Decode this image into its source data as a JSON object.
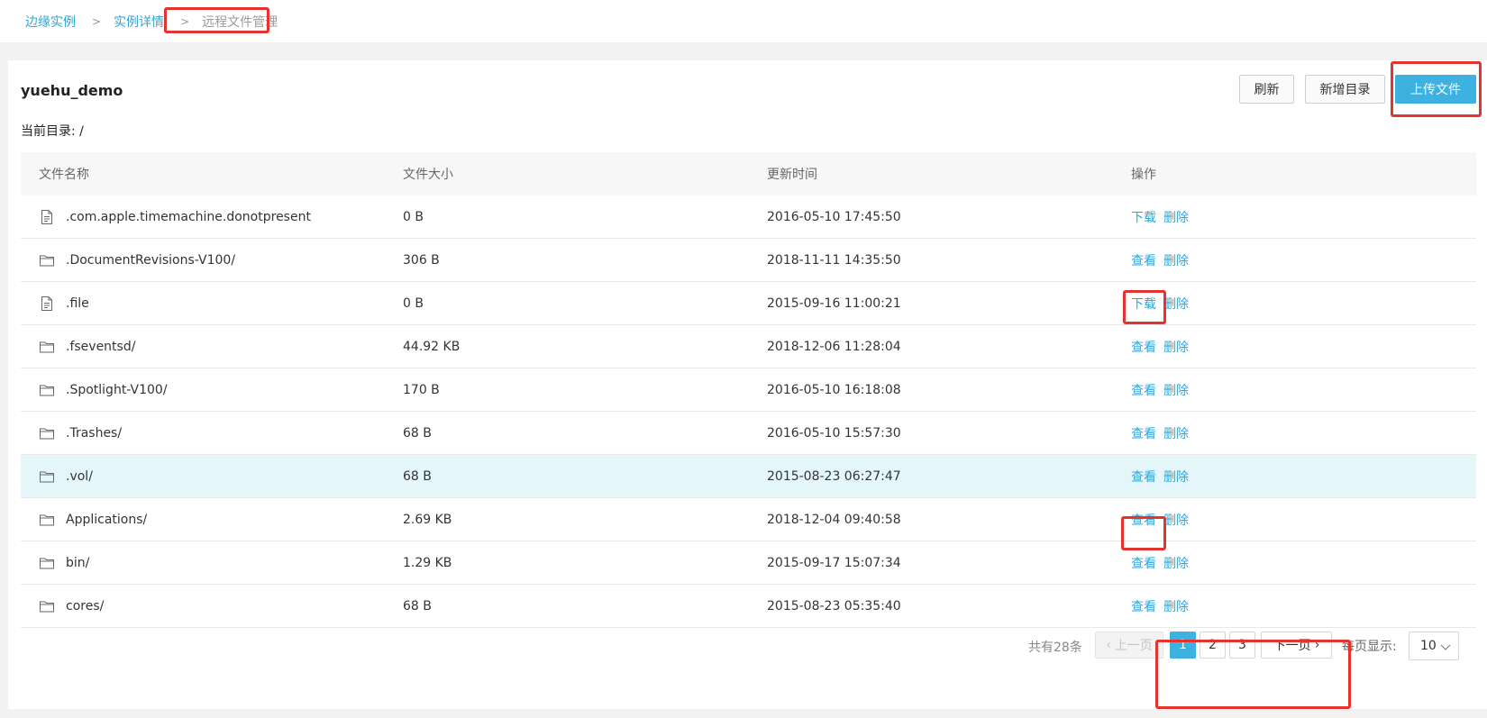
{
  "breadcrumb": {
    "items": [
      "边缘实例",
      "实例详情"
    ],
    "current": "远程文件管理",
    "separator": ">"
  },
  "instance": {
    "name": "yuehu_demo",
    "current_dir": "当前目录: /"
  },
  "toolbar": {
    "refresh_label": "刷新",
    "new_dir_label": "新增目录",
    "upload_label": "上传文件"
  },
  "table": {
    "headers": [
      "文件名称",
      "文件大小",
      "更新时间",
      "操作"
    ],
    "rows": [
      {
        "icon": "file-icon",
        "name": ".com.apple.timemachine.donotpresent",
        "size": "0 B",
        "time": "2016-05-10 17:45:50",
        "action": "下载",
        "delete": "删除"
      },
      {
        "icon": "folder-icon",
        "name": ".DocumentRevisions-V100/",
        "size": "306 B",
        "time": "2018-11-11 14:35:50",
        "action": "查看",
        "delete": "删除"
      },
      {
        "icon": "file-icon",
        "name": ".file",
        "size": "0 B",
        "time": "2015-09-16 11:00:21",
        "action": "下载",
        "delete": "删除"
      },
      {
        "icon": "folder-icon",
        "name": ".fseventsd/",
        "size": "44.92 KB",
        "time": "2018-12-06 11:28:04",
        "action": "查看",
        "delete": "删除"
      },
      {
        "icon": "folder-icon",
        "name": ".Spotlight-V100/",
        "size": "170 B",
        "time": "2016-05-10 16:18:08",
        "action": "查看",
        "delete": "删除"
      },
      {
        "icon": "folder-icon",
        "name": ".Trashes/",
        "size": "68 B",
        "time": "2016-05-10 15:57:30",
        "action": "查看",
        "delete": "删除"
      },
      {
        "icon": "folder-icon",
        "name": ".vol/",
        "size": "68 B",
        "time": "2015-08-23 06:27:47",
        "action": "查看",
        "delete": "删除"
      },
      {
        "icon": "folder-icon",
        "name": "Applications/",
        "size": "2.69 KB",
        "time": "2018-12-04 09:40:58",
        "action": "查看",
        "delete": "删除"
      },
      {
        "icon": "folder-icon",
        "name": "bin/",
        "size": "1.29 KB",
        "time": "2015-09-17 15:07:34",
        "action": "查看",
        "delete": "删除"
      },
      {
        "icon": "folder-icon",
        "name": "cores/",
        "size": "68 B",
        "time": "2015-08-23 05:35:40",
        "action": "查看",
        "delete": "删除"
      }
    ]
  },
  "pagination": {
    "total": "共有28条",
    "prev": "上一页",
    "pages": [
      "1",
      "2",
      "3"
    ],
    "current_page": "1",
    "next": "下一页",
    "per_page_label": "每页显示:",
    "per_page_value": "10"
  },
  "colors": {
    "accent": "#3db1df",
    "link": "#2fa6d4",
    "highlight_row": "#e5f6fa",
    "annotation": "#e3342f"
  }
}
